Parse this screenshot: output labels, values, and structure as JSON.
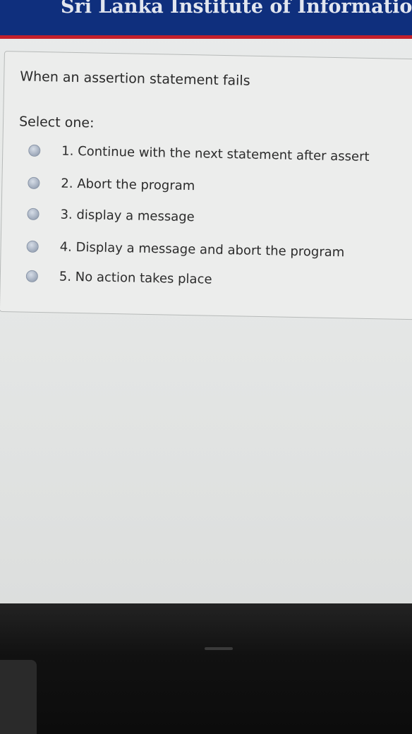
{
  "banner": {
    "title": "Sri Lanka Institute of Information T"
  },
  "question": {
    "text": "When an assertion statement fails",
    "prompt": "Select one:",
    "options": [
      {
        "label": "1. Continue with the next statement after assert",
        "selected": false
      },
      {
        "label": "2. Abort the program",
        "selected": false
      },
      {
        "label": "3. display a message",
        "selected": false
      },
      {
        "label": "4. Display a message and abort the program",
        "selected": false
      },
      {
        "label": "5. No action takes place",
        "selected": false
      }
    ]
  },
  "colors": {
    "banner_blue": "#0f2f7d",
    "banner_red_stripe": "#c3202b",
    "page_background": "#e9ebea",
    "radio_fill": "#9ea9ba"
  }
}
